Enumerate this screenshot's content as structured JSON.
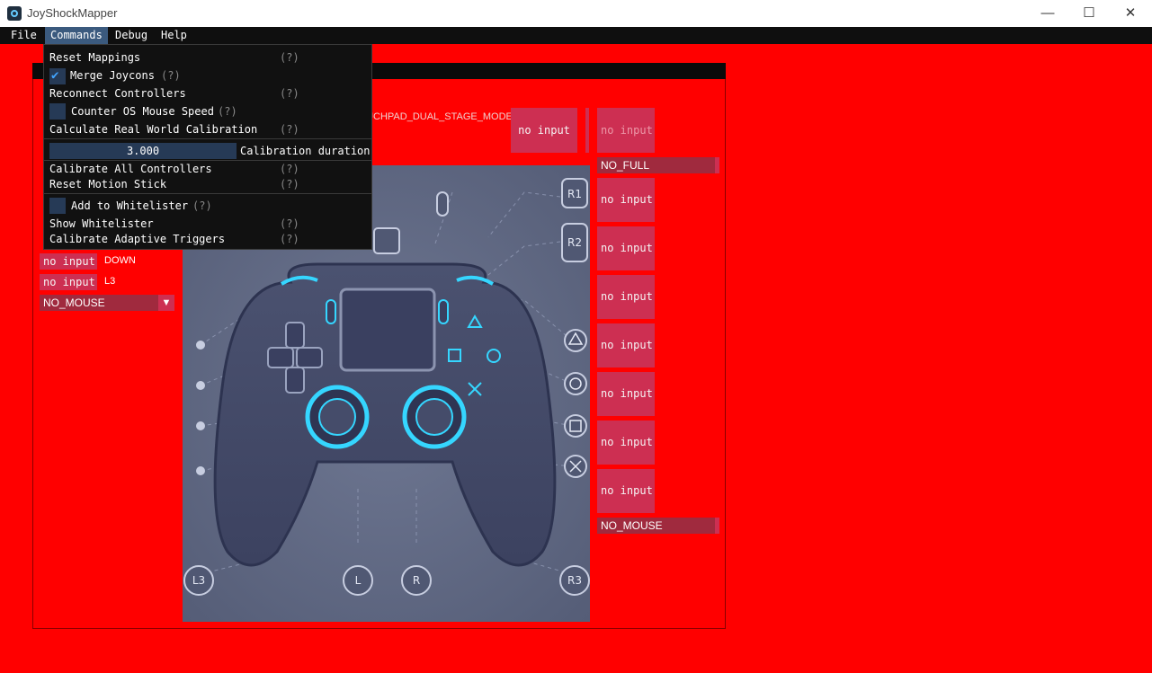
{
  "window": {
    "title": "JoyShockMapper",
    "minimize": "—",
    "maximize": "☐",
    "close": "✕"
  },
  "menubar": {
    "items": [
      "File",
      "Commands",
      "Debug",
      "Help"
    ]
  },
  "commands_menu": {
    "reset_mappings": "Reset Mappings",
    "merge_joycons": "Merge Joycons",
    "reconnect": "Reconnect Controllers",
    "counter_os": "Counter OS Mouse Speed",
    "calc_rwc": "Calculate Real World Calibration",
    "calib_value": "3.000",
    "calib_label": "Calibration duration",
    "calibrate_all": "Calibrate All Controllers",
    "reset_motion": "Reset Motion Stick",
    "add_whitelister": "Add to Whitelister",
    "show_whitelister": "Show Whitelister",
    "calib_adaptive": "Calibrate Adaptive Triggers",
    "help_marker": "(?)"
  },
  "left_panel": {
    "rows": [
      {
        "button": "no input",
        "label": "DOWN"
      },
      {
        "button": "no input",
        "label": "L3"
      }
    ],
    "mouse_combo": "NO_MOUSE"
  },
  "top_bar": {
    "touchpad_mode": "TOUCHPAD_DUAL_STAGE_MODE",
    "center_button": "no input",
    "right_top_button": "no input",
    "full_combo": "NO_FULL"
  },
  "right_panel": {
    "buttons": [
      "no input",
      "no input",
      "no input",
      "no input",
      "no input",
      "no input",
      "no input"
    ],
    "mouse_combo": "NO_MOUSE"
  },
  "controller": {
    "labels": {
      "r1": "R1",
      "r2": "R2",
      "l3": "L3",
      "l": "L",
      "r": "R",
      "r3": "R3"
    }
  }
}
